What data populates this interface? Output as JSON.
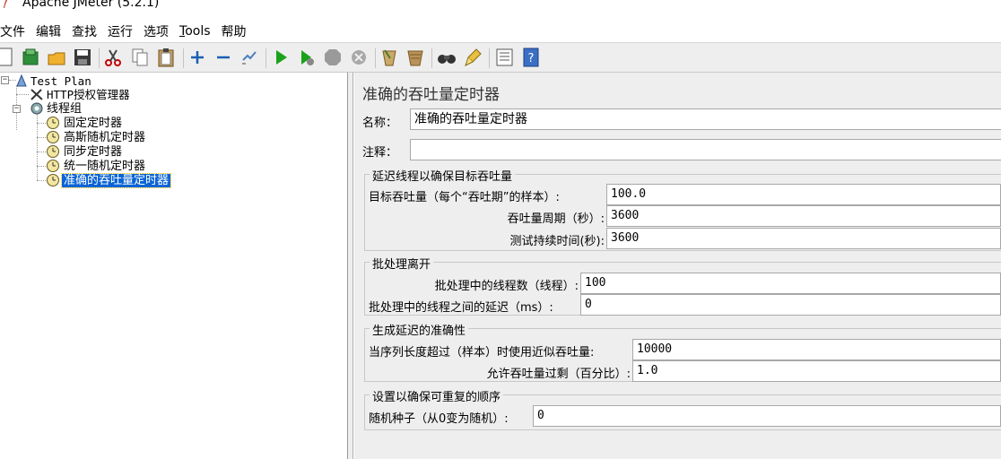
{
  "window": {
    "title": "Apache JMeter (5.2.1)"
  },
  "menu": [
    {
      "label": "文件"
    },
    {
      "label": "编辑"
    },
    {
      "label": "查找"
    },
    {
      "label": "运行"
    },
    {
      "label": "选项"
    },
    {
      "label_prefix": "T",
      "label_rest": "ools"
    },
    {
      "label": "帮助"
    }
  ],
  "toolbar": {
    "buttons": [
      "new-icon",
      "templates-icon",
      "open-icon",
      "save-icon",
      "cut-icon",
      "copy-icon",
      "paste-icon",
      "expand-icon",
      "collapse-icon",
      "toggle-icon",
      "start-icon",
      "start-no-pause-icon",
      "stop-icon",
      "shutdown-icon",
      "clear-icon",
      "clear-all-icon",
      "search-icon",
      "reset-search-icon",
      "function-helper-icon",
      "help-icon"
    ]
  },
  "tree": {
    "test_plan": "Test Plan",
    "http_auth": "HTTP授权管理器",
    "thread_group": "线程组",
    "timers": [
      "固定定时器",
      "高斯随机定时器",
      "同步定时器",
      "统一随机定时器",
      "准确的吞吐量定时器"
    ]
  },
  "panel": {
    "title": "准确的吞吐量定时器",
    "name_label": "名称：",
    "name_value": "准确的吞吐量定时器",
    "comment_label": "注释：",
    "comment_value": "",
    "group1": {
      "title": "延迟线程以确保目标吞吐量",
      "target_label": "目标吞吐量（每个“吞吐期”的样本）:",
      "target_value": "100.0",
      "period_label": "吞吐量周期（秒）:",
      "period_value": "3600",
      "duration_label": "测试持续时间(秒):",
      "duration_value": "3600"
    },
    "group2": {
      "title": "批处理离开",
      "threads_label": "批处理中的线程数（线程）:",
      "threads_value": "100",
      "delay_label": "批处理中的线程之间的延迟（ms）:",
      "delay_value": "0"
    },
    "group3": {
      "title": "生成延迟的准确性",
      "length_label": "当序列长度超过（样本）时使用近似吞吐量:",
      "length_value": "10000",
      "surplus_label": "允许吞吐量过剩（百分比）:",
      "surplus_value": "1.0"
    },
    "group4": {
      "title": "设置以确保可重复的顺序",
      "seed_label": "随机种子（从0变为随机）:",
      "seed_value": "0"
    }
  },
  "colors": {
    "selection": "#0a64d6",
    "panel_bg": "#eeeeee",
    "start_green": "#1aa21a"
  }
}
